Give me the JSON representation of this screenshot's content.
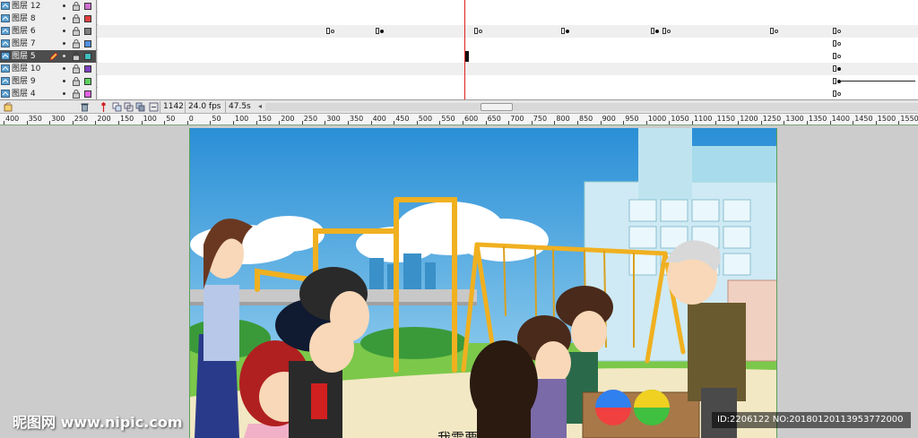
{
  "layers": [
    {
      "name": "图层 12",
      "color": "#d070d0",
      "selected": false
    },
    {
      "name": "图层 8",
      "color": "#e04040",
      "selected": false
    },
    {
      "name": "图层 6",
      "color": "#808080",
      "selected": false
    },
    {
      "name": "图层 7",
      "color": "#5090e0",
      "selected": false
    },
    {
      "name": "图层 5",
      "color": "#40c0c0",
      "selected": true
    },
    {
      "name": "图层 10",
      "color": "#8040c0",
      "selected": false
    },
    {
      "name": "图层 9",
      "color": "#60d060",
      "selected": false
    },
    {
      "name": "图层 4",
      "color": "#e060e0",
      "selected": false
    }
  ],
  "statusbar": {
    "frame": "1142",
    "fps": "24.0 fps",
    "elapsed": "47.5s"
  },
  "ruler": {
    "labels": [
      "400",
      "350",
      "300",
      "250",
      "200",
      "150",
      "100",
      "50",
      "0",
      "50",
      "100",
      "150",
      "200",
      "250",
      "300",
      "350",
      "400",
      "450",
      "500",
      "550",
      "600",
      "650",
      "700",
      "750",
      "800",
      "850",
      "900",
      "950",
      "1000",
      "1050",
      "1100",
      "1150",
      "1200",
      "1250",
      "1300",
      "1350",
      "1400",
      "1450",
      "1500",
      "1550"
    ]
  },
  "stage": {
    "subtitle": "我需要..."
  },
  "watermarks": {
    "left": "昵图网 www.nipic.com",
    "right": "ID:2206122 NO:20180120113953772000"
  },
  "colors": {
    "sky": "#5ab4e8",
    "grass": "#7cc84a",
    "swing_frame": "#f0b020",
    "stage_border": "#5aa05a"
  }
}
